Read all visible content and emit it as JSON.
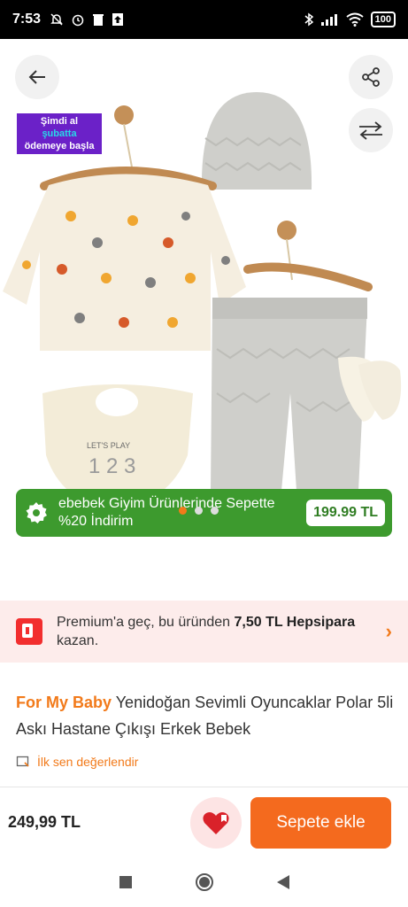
{
  "status_bar": {
    "time": "7:53",
    "battery": "100"
  },
  "promo_badge": {
    "line1": "Şimdi al",
    "line2": "şubatta",
    "line3": "ödemeye başla"
  },
  "discount_banner": {
    "text": "ebebek Giyim Ürünlerinde Sepette %20  İndirim",
    "price": "199.99 TL"
  },
  "gallery": {
    "total_images": 3,
    "active_index": 0
  },
  "premium": {
    "prefix": "Premium'a geç, bu üründen ",
    "amount": "7,50 TL Hepsipara",
    "suffix": " kazan."
  },
  "product": {
    "brand": "For My Baby",
    "name": " Yenidoğan Sevimli Oyuncaklar Polar 5li Askı Hastane Çıkışı Erkek Bebek",
    "rate_label": "İlk sen değerlendir"
  },
  "buy_bar": {
    "price": "249,99 TL",
    "add_to_cart": "Sepete ekle"
  },
  "colors": {
    "accent": "#f27a1a",
    "discount_green": "#3d9a2e",
    "promo_purple": "#6b21c8",
    "premium_bg": "#fdeceb"
  }
}
